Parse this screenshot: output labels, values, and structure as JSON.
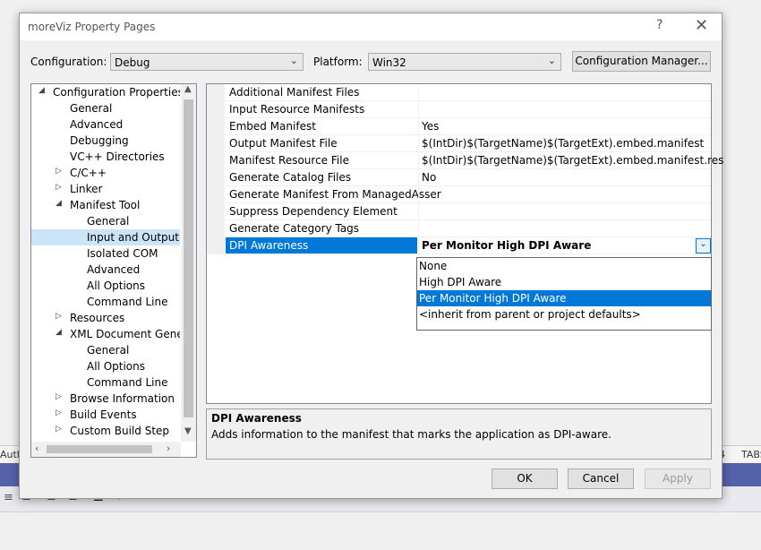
{
  "background": {
    "status_left": "Autho",
    "status_num": "4",
    "status_tabs": "TABS",
    "toolbar_icons": [
      "align-left-icon",
      "align-center-icon",
      "align-right-icon",
      "justify-icon",
      "wrap-icon"
    ]
  },
  "dialog": {
    "title": "moreViz Property Pages",
    "help": "?",
    "close": "✕",
    "configuration_label": "Configuration:",
    "configuration_value": "Debug",
    "platform_label": "Platform:",
    "platform_value": "Win32",
    "config_manager_label": "Configuration Manager...",
    "ok_label": "OK",
    "cancel_label": "Cancel",
    "apply_label": "Apply"
  },
  "tree": {
    "items": [
      {
        "label": "Configuration Properties",
        "expander": "◢",
        "level": 0
      },
      {
        "label": "General",
        "expander": "",
        "level": 1
      },
      {
        "label": "Advanced",
        "expander": "",
        "level": 1
      },
      {
        "label": "Debugging",
        "expander": "",
        "level": 1
      },
      {
        "label": "VC++ Directories",
        "expander": "",
        "level": 1
      },
      {
        "label": "C/C++",
        "expander": "▷",
        "level": 1
      },
      {
        "label": "Linker",
        "expander": "▷",
        "level": 1
      },
      {
        "label": "Manifest Tool",
        "expander": "◢",
        "level": 1
      },
      {
        "label": "General",
        "expander": "",
        "level": 2
      },
      {
        "label": "Input and Output",
        "expander": "",
        "level": 2
      },
      {
        "label": "Isolated COM",
        "expander": "",
        "level": 2
      },
      {
        "label": "Advanced",
        "expander": "",
        "level": 2
      },
      {
        "label": "All Options",
        "expander": "",
        "level": 2
      },
      {
        "label": "Command Line",
        "expander": "",
        "level": 2
      },
      {
        "label": "Resources",
        "expander": "▷",
        "level": 1
      },
      {
        "label": "XML Document Genera",
        "expander": "◢",
        "level": 1
      },
      {
        "label": "General",
        "expander": "",
        "level": 2
      },
      {
        "label": "All Options",
        "expander": "",
        "level": 2
      },
      {
        "label": "Command Line",
        "expander": "",
        "level": 2
      },
      {
        "label": "Browse Information",
        "expander": "▷",
        "level": 1
      },
      {
        "label": "Build Events",
        "expander": "▷",
        "level": 1
      },
      {
        "label": "Custom Build Step",
        "expander": "▷",
        "level": 1
      }
    ],
    "selected_index": 9
  },
  "grid": {
    "rows": [
      {
        "name": "Additional Manifest Files",
        "value": ""
      },
      {
        "name": "Input Resource Manifests",
        "value": ""
      },
      {
        "name": "Embed Manifest",
        "value": "Yes"
      },
      {
        "name": "Output Manifest File",
        "value": "$(IntDir)$(TargetName)$(TargetExt).embed.manifest"
      },
      {
        "name": "Manifest Resource File",
        "value": "$(IntDir)$(TargetName)$(TargetExt).embed.manifest.res"
      },
      {
        "name": "Generate Catalog Files",
        "value": "No"
      },
      {
        "name": "Generate Manifest From ManagedAsser",
        "value": ""
      },
      {
        "name": "Suppress Dependency Element",
        "value": ""
      },
      {
        "name": "Generate Category Tags",
        "value": ""
      },
      {
        "name": "DPI Awareness",
        "value": "Per Monitor High DPI Aware"
      }
    ],
    "selected_index": 9,
    "dropdown_options": [
      "None",
      "High DPI Aware",
      "Per Monitor High DPI Aware",
      "<inherit from parent or project defaults>"
    ],
    "dropdown_selected_index": 2
  },
  "description": {
    "title": "DPI Awareness",
    "body": "Adds information to the manifest that marks the application as DPI-aware."
  },
  "colors": {
    "selection": "#0078d7",
    "tree_selection": "#cce4f7",
    "ide_blue": "#5561a9"
  }
}
